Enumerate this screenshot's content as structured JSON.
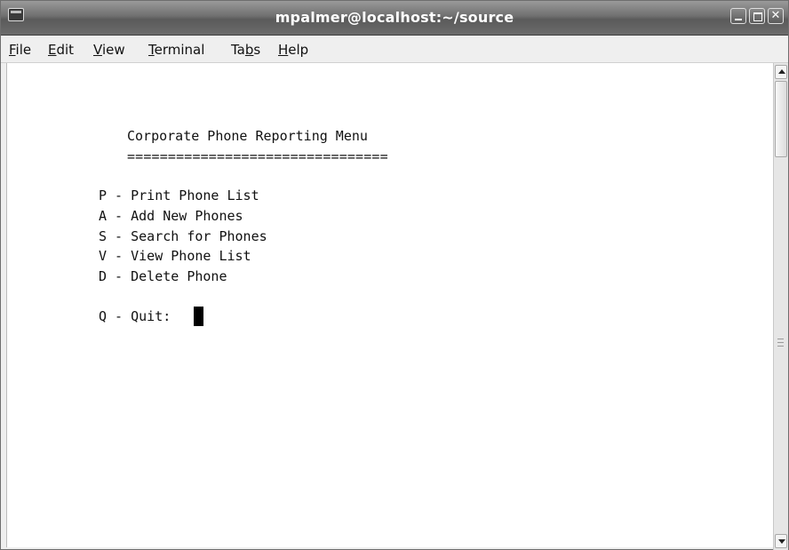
{
  "window": {
    "title": "mpalmer@localhost:~/source"
  },
  "menubar": {
    "file": {
      "accel": "F",
      "rest": "ile"
    },
    "edit": {
      "accel": "E",
      "rest": "dit"
    },
    "view": {
      "accel": "V",
      "rest": "iew"
    },
    "terminal": {
      "accel": "T",
      "rest": "erminal"
    },
    "tabs": {
      "pre": "Ta",
      "accel": "b",
      "rest": "s"
    },
    "help": {
      "accel": "H",
      "rest": "elp"
    }
  },
  "terminal": {
    "menu_title": "Corporate Phone Reporting Menu",
    "underline": "================================",
    "options": [
      "P - Print Phone List",
      "A - Add New Phones",
      "S - Search for Phones",
      "V - View Phone List",
      "D - Delete Phone"
    ],
    "prompt": "Q - Quit: "
  },
  "colors": {
    "titlebar": "#6f6f6f",
    "terminal_bg": "#ffffff",
    "terminal_fg": "#111111"
  }
}
